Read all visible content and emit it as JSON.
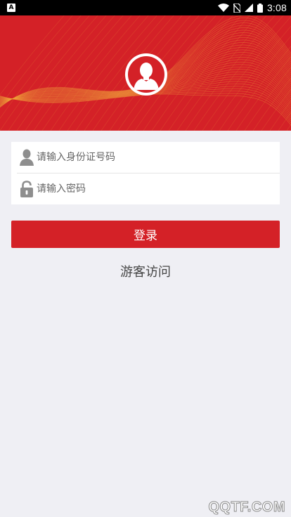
{
  "status_bar": {
    "notification_icon": "A",
    "time": "3:08",
    "icons": [
      "wifi-icon",
      "no-sim-icon",
      "signal-icon",
      "battery-icon"
    ]
  },
  "header": {
    "background_color": "#d42127",
    "avatar_icon": "user-silhouette-icon"
  },
  "login_form": {
    "id_field": {
      "placeholder": "请输入身份证号码",
      "value": "",
      "icon": "user-icon"
    },
    "password_field": {
      "placeholder": "请输入密码",
      "value": "",
      "icon": "lock-icon"
    }
  },
  "buttons": {
    "login_label": "登录",
    "guest_label": "游客访问"
  },
  "watermark": "QQTF.COM",
  "colors": {
    "accent": "#d42127",
    "background": "#efeff4",
    "icon_gray": "#8e8e8e"
  }
}
